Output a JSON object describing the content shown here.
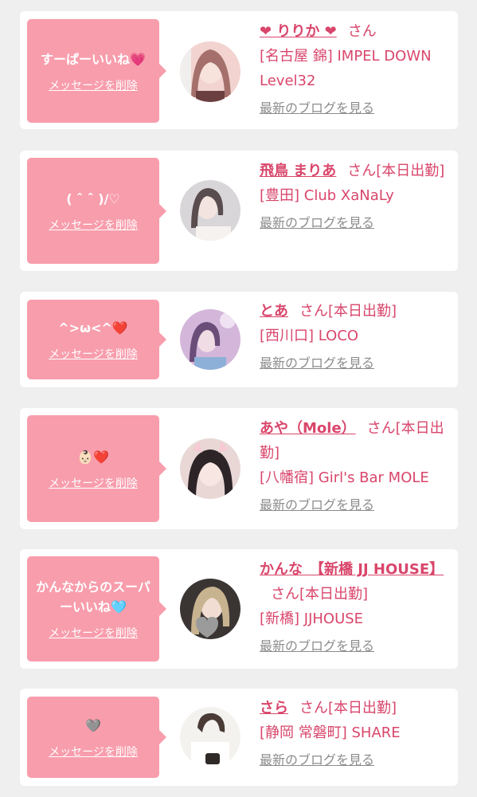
{
  "cards": [
    {
      "message": "すーぱーいいね",
      "emoji": "💗",
      "delete_label": "メッセージを削除",
      "name": "❤ りりか ❤",
      "honorific": "さん",
      "status": "",
      "store": "[名古屋 錦] IMPEL DOWN Level32",
      "blog_link": "最新のブログを見る",
      "avatar_colors": [
        "#f2d3cf",
        "#a5706b"
      ]
    },
    {
      "message": "( ˆ ˆ )/♡",
      "emoji": "",
      "delete_label": "メッセージを削除",
      "name": "飛鳥 まりあ",
      "honorific": "さん",
      "status": "[本日出勤]",
      "store": "[豊田] Club XaNaLy",
      "blog_link": "最新のブログを見る",
      "avatar_colors": [
        "#d9d6d9",
        "#5a4d4f"
      ]
    },
    {
      "message": "^>ω<^",
      "emoji": "❤️",
      "delete_label": "メッセージを削除",
      "name": "とあ",
      "honorific": "さん",
      "status": "[本日出勤]",
      "store": "[西川口] LOCO",
      "blog_link": "最新のブログを見る",
      "avatar_colors": [
        "#d3b6da",
        "#6a4d78"
      ]
    },
    {
      "message": "",
      "emoji": "👶🏻❤️",
      "delete_label": "メッセージを削除",
      "name": "あや（Mole）",
      "honorific": "さん",
      "status": "[本日出勤]",
      "store": "[八幡宿] Girl's Bar MOLE",
      "blog_link": "最新のブログを見る",
      "avatar_colors": [
        "#e8d7d5",
        "#2d2427"
      ]
    },
    {
      "message": "かんなからのスーパーいいね",
      "emoji": "🩵",
      "delete_label": "メッセージを削除",
      "name": "かんな　【新橋 JJ HOUSE】",
      "honorific": "さん",
      "status": "[本日出勤]",
      "store": "[新橋] JJHOUSE",
      "blog_link": "最新のブログを見る",
      "avatar_colors": [
        "#c8b390",
        "#3a3533"
      ]
    },
    {
      "message": "",
      "emoji": "🩶",
      "delete_label": "メッセージを削除",
      "name": "さら",
      "honorific": "さん",
      "status": "[本日出勤]",
      "store": "[静岡 常磐町] SHARE",
      "blog_link": "最新のブログを見る",
      "avatar_colors": [
        "#f4f2ef",
        "#4a3b36"
      ]
    }
  ]
}
